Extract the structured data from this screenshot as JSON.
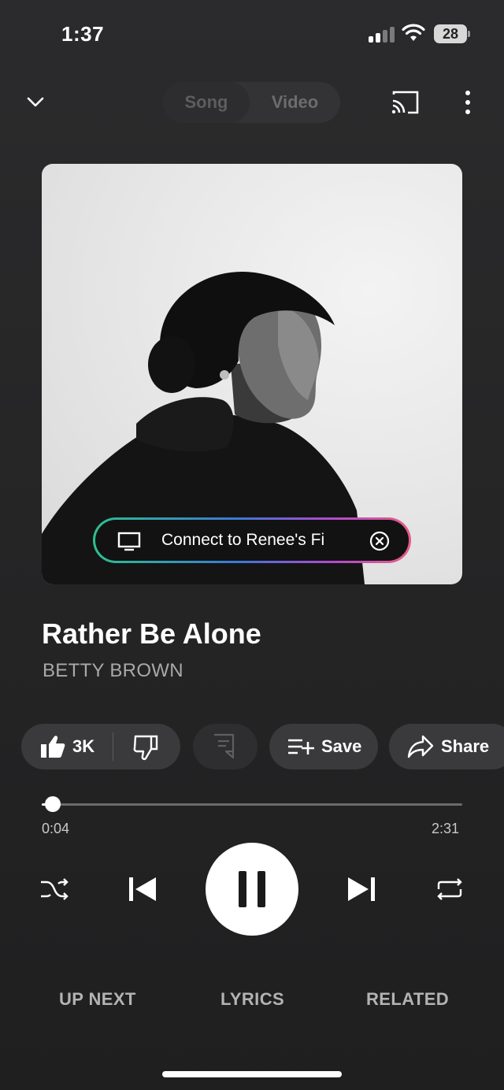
{
  "status_bar": {
    "time": "1:37",
    "battery": "28"
  },
  "top_bar": {
    "toggle_song": "Song",
    "toggle_video": "Video"
  },
  "connect_banner": {
    "text": "Connect to Renee's Fi"
  },
  "track": {
    "title": "Rather Be Alone",
    "artist": "BETTY BROWN"
  },
  "actions": {
    "like_count": "3K",
    "save_label": "Save",
    "share_label": "Share"
  },
  "progress": {
    "current": "0:04",
    "total": "2:31",
    "fraction": 0.026
  },
  "tabs": [
    "UP NEXT",
    "LYRICS",
    "RELATED"
  ],
  "icons": [
    "chevron-down-icon",
    "cast-icon",
    "more-vert-icon",
    "tv-icon",
    "close-circle-icon",
    "thumb-up-icon",
    "thumb-down-icon",
    "comment-icon",
    "playlist-add-icon",
    "share-icon",
    "shuffle-icon",
    "skip-previous-icon",
    "pause-icon",
    "skip-next-icon",
    "repeat-icon"
  ],
  "colors": {
    "background": "#262627",
    "accent_gradient": [
      "#2fbf8f",
      "#3a79d6",
      "#b04ad0",
      "#e65b86"
    ]
  }
}
